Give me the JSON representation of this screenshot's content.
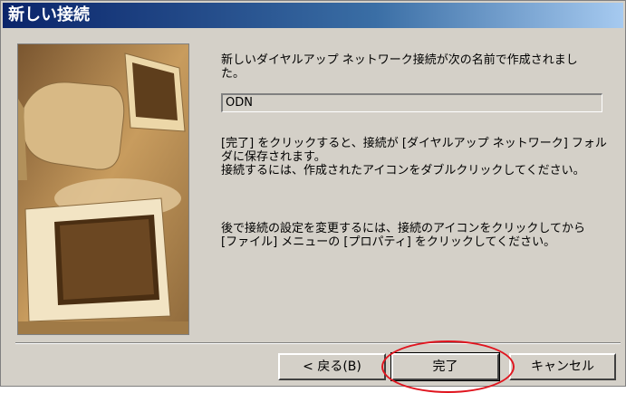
{
  "window": {
    "title": "新しい接続"
  },
  "illustration": {
    "icon": "computer-monitors-illustration"
  },
  "content": {
    "created_line1": "新しいダイヤルアップ ネットワーク接続が次の名前で作成されまし",
    "created_line2": "た。",
    "connection_name": "ODN",
    "info1_line1": "[完了] をクリックすると、接続が [ダイヤルアップ ネットワーク] フォル",
    "info1_line2": "ダに保存されます。",
    "info1_line3": "接続するには、作成されたアイコンをダブルクリックしてください。",
    "info2_line1": "後で接続の設定を変更するには、接続のアイコンをクリックしてから",
    "info2_line2": "[ファイル] メニューの [プロパティ] をクリックしてください。"
  },
  "buttons": {
    "back": "< 戻る(B)",
    "finish": "完了",
    "cancel": "キャンセル"
  },
  "colors": {
    "title_start": "#0a246a",
    "title_end": "#a6caf0",
    "dialog_bg": "#d4d0c8",
    "highlight": "#e0141e"
  }
}
